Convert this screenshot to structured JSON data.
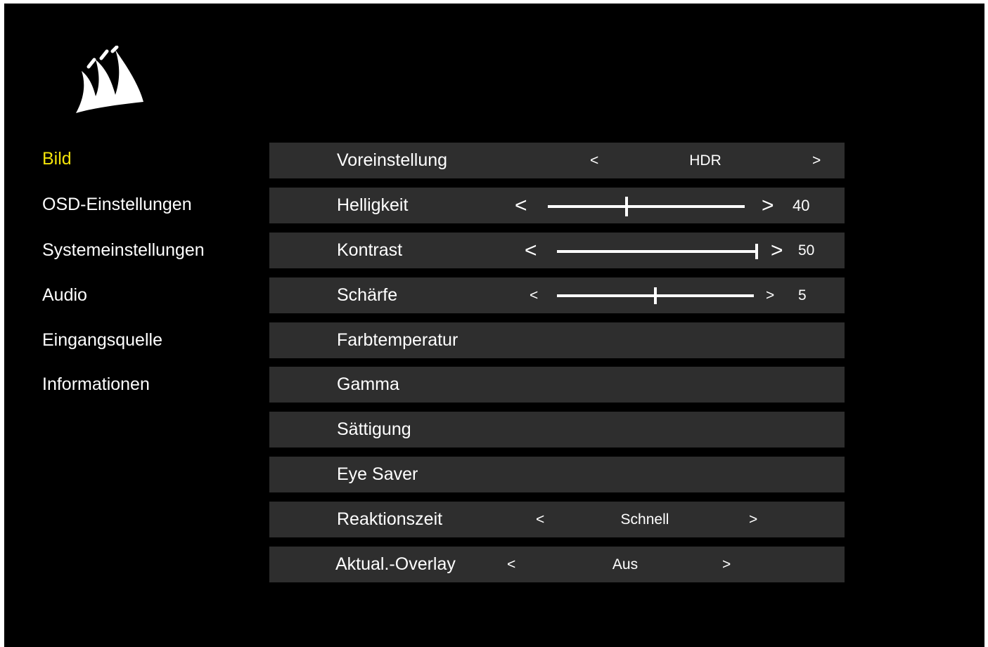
{
  "colors": {
    "background": "#000000",
    "row_background": "#2e2e2e",
    "active_nav": "#f2e20a",
    "text": "#ffffff"
  },
  "logo": {
    "icon": "corsair-sails-logo"
  },
  "nav": {
    "items": [
      {
        "label": "Bild",
        "active": true
      },
      {
        "label": "OSD-Einstellungen",
        "active": false
      },
      {
        "label": "Systemeinstellungen",
        "active": false
      },
      {
        "label": "Audio",
        "active": false
      },
      {
        "label": "Eingangsquelle",
        "active": false
      },
      {
        "label": "Informationen",
        "active": false
      }
    ]
  },
  "settings": {
    "voreinstellung": {
      "label": "Voreinstellung",
      "prev": "<",
      "value": "HDR",
      "next": ">"
    },
    "helligkeit": {
      "label": "Helligkeit",
      "prev": "<",
      "next": ">",
      "value": "40",
      "level": 0.4
    },
    "kontrast": {
      "label": "Kontrast",
      "prev": "<",
      "next": ">",
      "value": "50",
      "level": 1.0
    },
    "schaerfe": {
      "label": "Schärfe",
      "prev": "<",
      "next": ">",
      "value": "5",
      "level": 0.5
    },
    "farbtemperatur": {
      "label": "Farbtemperatur"
    },
    "gamma": {
      "label": "Gamma"
    },
    "saettigung": {
      "label": "Sättigung"
    },
    "eye_saver": {
      "label": "Eye Saver"
    },
    "reaktionszeit": {
      "label": "Reaktionszeit",
      "prev": "<",
      "value": "Schnell",
      "next": ">"
    },
    "overlay": {
      "label": "Aktual.-Overlay",
      "prev": "<",
      "value": "Aus",
      "next": ">"
    }
  }
}
